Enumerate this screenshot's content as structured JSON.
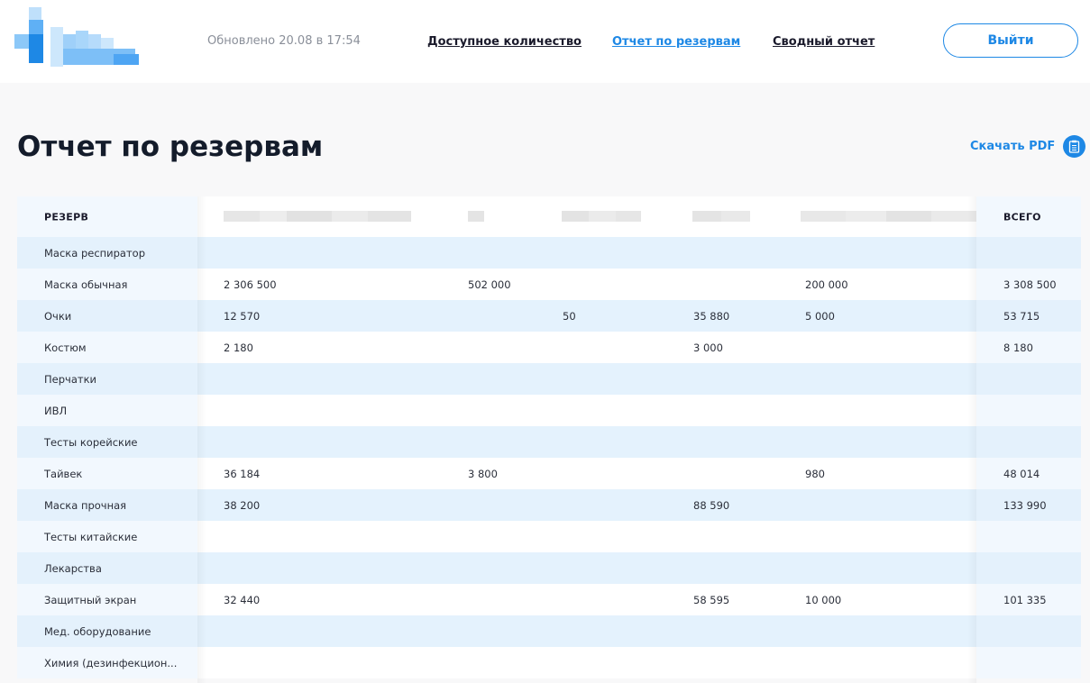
{
  "header": {
    "updated": "Обновлено 20.08 в 17:54",
    "nav": {
      "available": "Доступное количество",
      "reserve": "Отчет по резервам",
      "summary": "Сводный отчет"
    },
    "logout": "Выйти"
  },
  "page": {
    "title": "Отчет по резервам",
    "download": "Скачать PDF"
  },
  "colors": {
    "accent": "#1e88e5",
    "row_highlight": "#e4f2fd"
  },
  "table": {
    "col_reserve": "РЕЗЕРВ",
    "col_total": "ВСЕГО",
    "rows": [
      {
        "name": "Маска респиратор",
        "c1": "",
        "c2": "",
        "c3": "",
        "c4": "",
        "c5": "",
        "total": ""
      },
      {
        "name": "Маска обычная",
        "c1": "2 306 500",
        "c2": "502 000",
        "c3": "",
        "c4": "",
        "c5": "200 000",
        "total": "3 308 500"
      },
      {
        "name": "Очки",
        "c1": "12 570",
        "c2": "",
        "c3": "50",
        "c4": "35 880",
        "c5": "5 000",
        "total": "53 715"
      },
      {
        "name": "Костюм",
        "c1": "2 180",
        "c2": "",
        "c3": "",
        "c4": "3 000",
        "c5": "",
        "total": "8 180"
      },
      {
        "name": "Перчатки",
        "c1": "",
        "c2": "",
        "c3": "",
        "c4": "",
        "c5": "",
        "total": ""
      },
      {
        "name": "ИВЛ",
        "c1": "",
        "c2": "",
        "c3": "",
        "c4": "",
        "c5": "",
        "total": ""
      },
      {
        "name": "Тесты корейские",
        "c1": "",
        "c2": "",
        "c3": "",
        "c4": "",
        "c5": "",
        "total": ""
      },
      {
        "name": "Тайвек",
        "c1": "36 184",
        "c2": "3 800",
        "c3": "",
        "c4": "",
        "c5": "980",
        "total": "48 014"
      },
      {
        "name": "Маска прочная",
        "c1": "38 200",
        "c2": "",
        "c3": "",
        "c4": "88 590",
        "c5": "",
        "total": "133 990"
      },
      {
        "name": "Тесты китайские",
        "c1": "",
        "c2": "",
        "c3": "",
        "c4": "",
        "c5": "",
        "total": ""
      },
      {
        "name": "Лекарства",
        "c1": "",
        "c2": "",
        "c3": "",
        "c4": "",
        "c5": "",
        "total": ""
      },
      {
        "name": "Защитный экран",
        "c1": "32 440",
        "c2": "",
        "c3": "",
        "c4": "58 595",
        "c5": "10 000",
        "total": "101 335"
      },
      {
        "name": "Мед. оборудование",
        "c1": "",
        "c2": "",
        "c3": "",
        "c4": "",
        "c5": "",
        "total": ""
      },
      {
        "name": "Химия (дезинфекцион...",
        "c1": "",
        "c2": "",
        "c3": "",
        "c4": "",
        "c5": "",
        "total": ""
      }
    ]
  }
}
